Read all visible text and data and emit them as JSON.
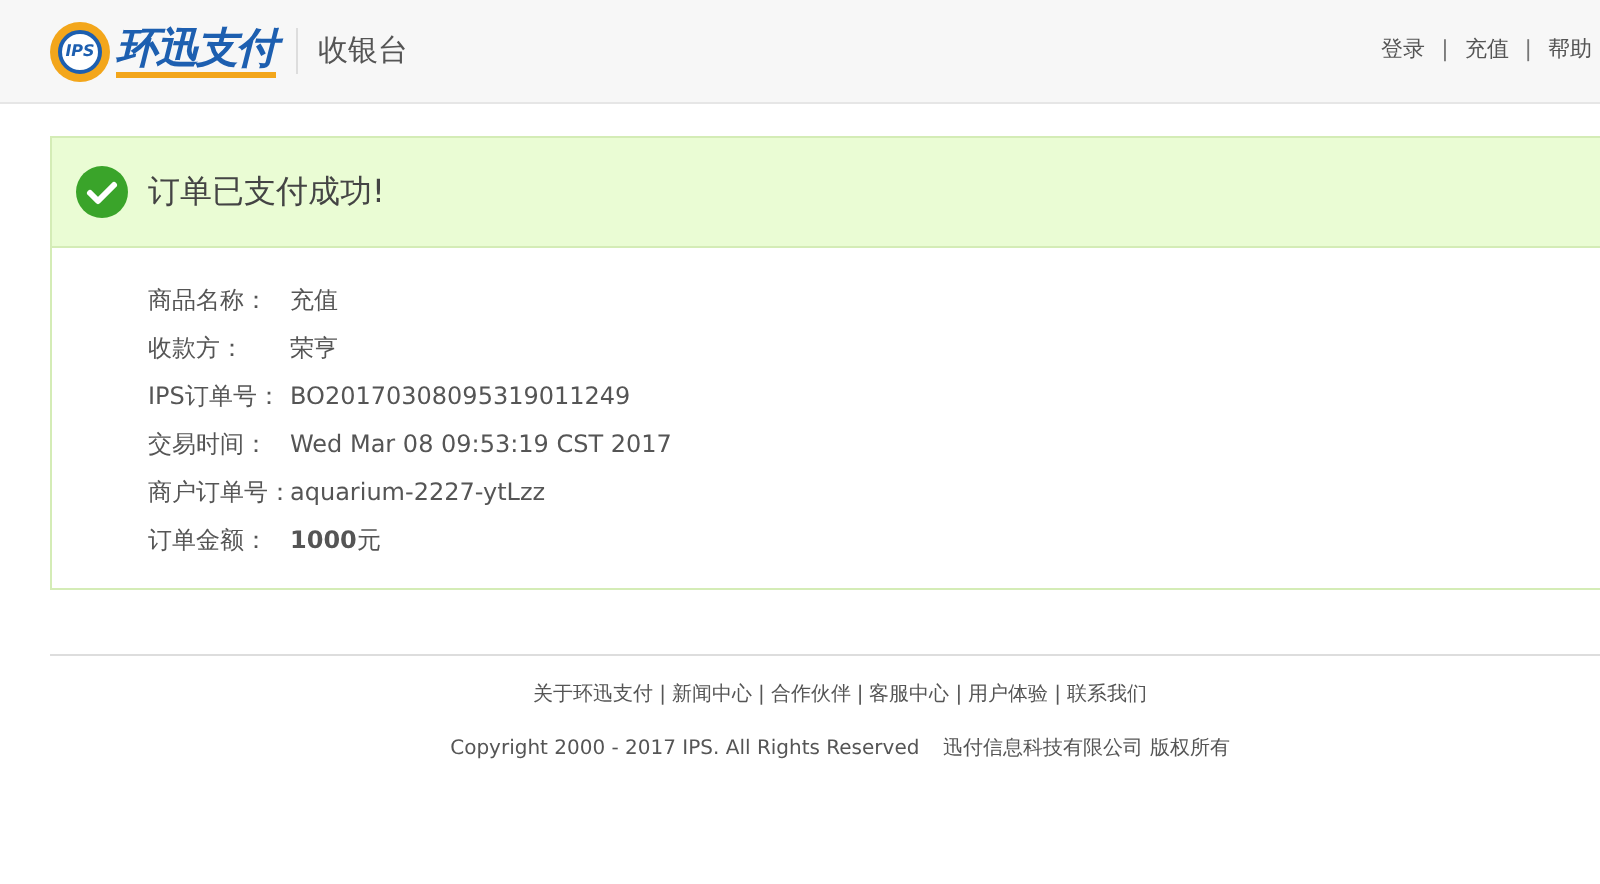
{
  "header": {
    "logo": {
      "badge": "IPS",
      "name": "环迅支付"
    },
    "subtitle": "收银台",
    "nav": [
      "登录",
      "充值",
      "帮助"
    ],
    "separator": "|"
  },
  "result": {
    "message": "订单已支付成功!",
    "success": true
  },
  "details": [
    {
      "label": "商品名称：",
      "value": "充值"
    },
    {
      "label": "收款方：",
      "value": "荣亨"
    },
    {
      "label": "IPS订单号：",
      "value": "BO20170308095319011249"
    },
    {
      "label": "交易时间：",
      "value": "Wed Mar 08 09:53:19 CST 2017"
    },
    {
      "label": "商户订单号：",
      "value": "aquarium-2227-ytLzz"
    },
    {
      "label": "订单金额：",
      "value": "**1000**元"
    }
  ],
  "footer": {
    "links": [
      "关于环迅支付",
      "新闻中心",
      "合作伙伴",
      "客服中心",
      "用户体验",
      "联系我们"
    ],
    "separator": "|",
    "copyright": "Copyright 2000 - 2017 IPS. All Rights Reserved",
    "company": "迅付信息科技有限公司 版权所有"
  }
}
